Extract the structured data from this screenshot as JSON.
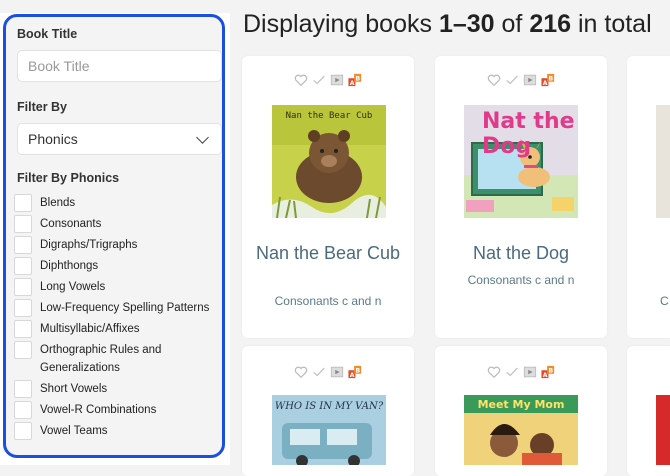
{
  "sidebar": {
    "book_title_label": "Book Title",
    "book_title_placeholder": "Book Title",
    "filter_by_label": "Filter By",
    "filter_by_value": "Phonics",
    "filter_by_phonics_label": "Filter By Phonics",
    "phonics_options": [
      "Blends",
      "Consonants",
      "Digraphs/Trigraphs",
      "Diphthongs",
      "Long Vowels",
      "Low-Frequency Spelling Patterns",
      "Multisyllabic/Affixes",
      "Orthographic Rules and Generalizations",
      "Short Vowels",
      "Vowel-R Combinations",
      "Vowel Teams"
    ]
  },
  "main": {
    "heading_prefix": "Displaying books ",
    "range": "1–30",
    "of": " of ",
    "total": "216",
    "suffix": " in total",
    "books": [
      {
        "title": "Nan the Bear Cub",
        "subtitle": "Consonants c and n",
        "cover_text": "Nan the Bear Cub"
      },
      {
        "title": "Nat the Dog",
        "subtitle": "Consonants c and n",
        "cover_text": "Nat the Dog"
      }
    ],
    "partial_right_subtitle": "C",
    "row2_cover_texts": [
      "WHO IS IN MY VAN?",
      "Meet My Mom"
    ]
  },
  "colors": {
    "accent_border": "#1a4fe0",
    "title_color": "#4a6a80"
  }
}
